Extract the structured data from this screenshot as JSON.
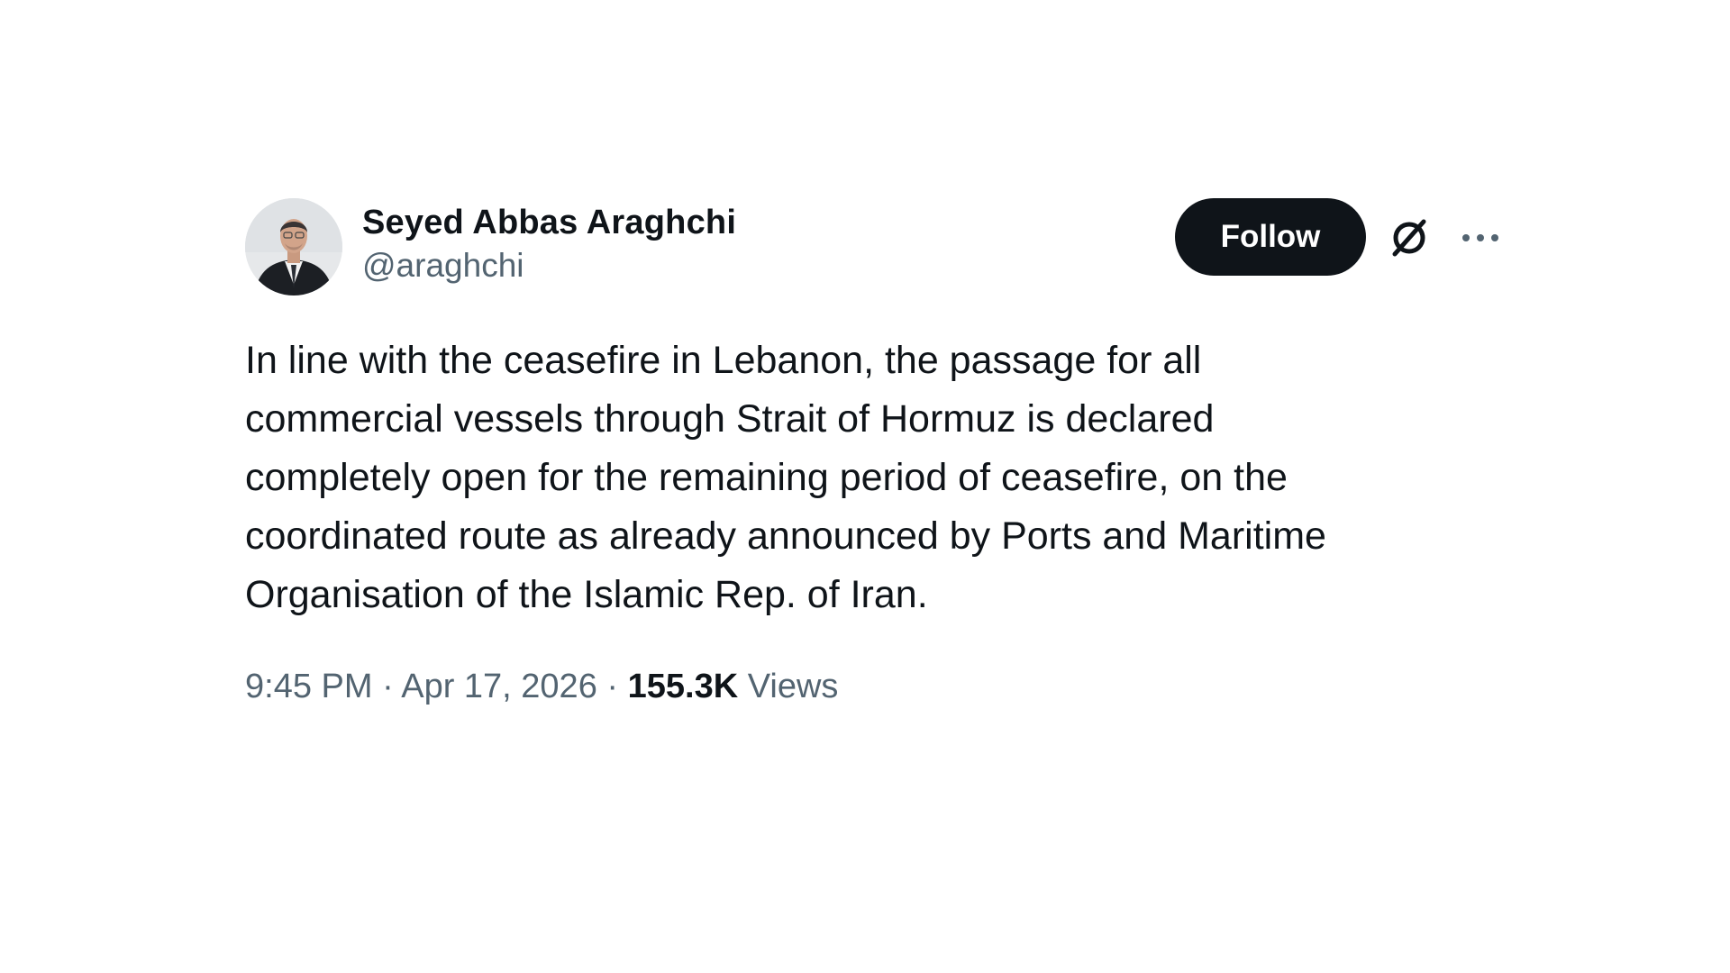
{
  "author": {
    "display_name": "Seyed Abbas Araghchi",
    "handle": "@araghchi",
    "avatar_icon": "profile-photo"
  },
  "actions": {
    "follow_label": "Follow",
    "grok_icon": "grok-icon",
    "more_icon": "more-options-icon"
  },
  "tweet": {
    "text": "In line with the ceasefire in Lebanon, the passage for all\ncommercial vessels through Strait of Hormuz is declared\ncompletely open for the remaining period of ceasefire, on the\ncoordinated route as already announced by Ports and Maritime\nOrganisation of the Islamic Rep. of Iran."
  },
  "meta": {
    "time": "9:45 PM",
    "separator": "·",
    "date": "Apr 17, 2026",
    "views_count": "155.3K",
    "views_label": "Views"
  },
  "colors": {
    "text_primary": "#0f1419",
    "text_secondary": "#536471",
    "button_bg": "#0f1419",
    "background": "#ffffff"
  }
}
